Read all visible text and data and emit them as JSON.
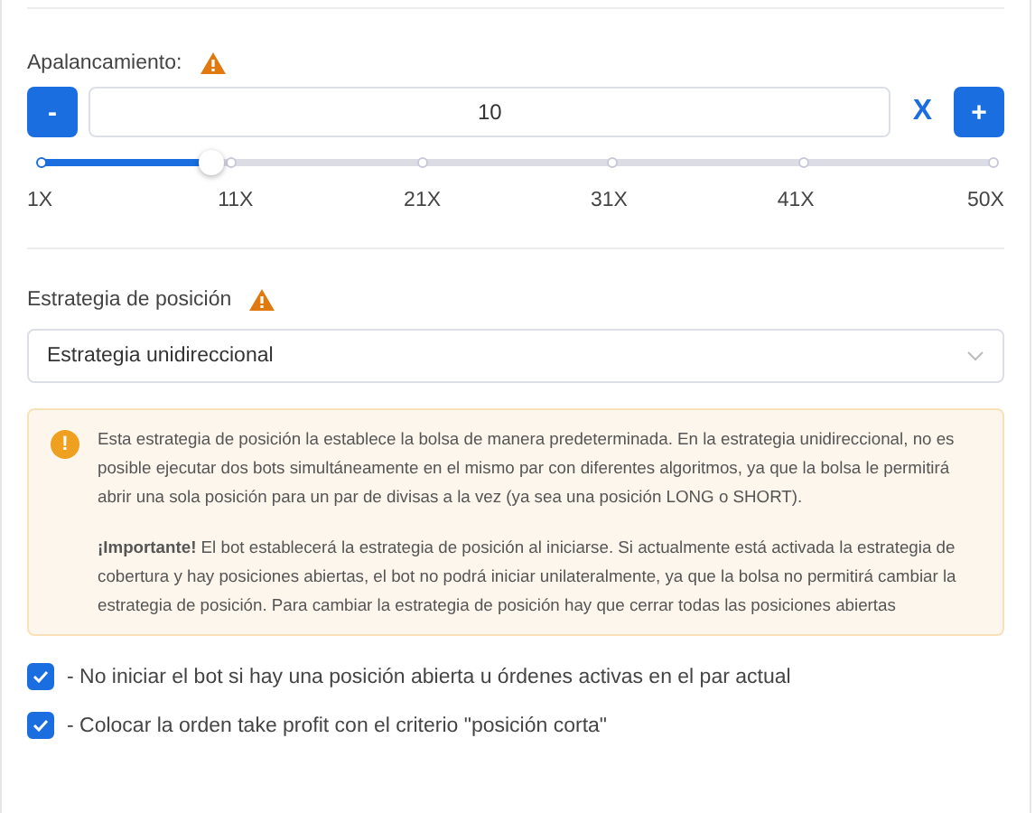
{
  "leverage": {
    "label": "Apalancamiento:",
    "minus": "-",
    "value": "10",
    "unit": "X",
    "plus": "+",
    "level": 0.184,
    "ticks": [
      "1X",
      "11X",
      "21X",
      "31X",
      "41X",
      "50X"
    ]
  },
  "strategy": {
    "label": "Estrategia de posición",
    "value": "Estrategia unidireccional"
  },
  "alert": {
    "icon": "!",
    "paragraphs": [
      "Esta estrategia de posición la establece la bolsa de manera predeterminada. En la estrategia unidireccional, no es posible ejecutar dos bots simultáneamente en el mismo par con diferentes algoritmos, ya que la bolsa le permitirá abrir una sola posición para un par de divisas a la vez (ya sea una posición LONG o SHORT).",
      "**¡Importante!** El bot establecerá la estrategia de posición al iniciarse. Si actualmente está activada la estrategia de cobertura y hay posiciones abiertas, el bot no podrá iniciar unilateralmente, ya que la bolsa no permitirá cambiar la estrategia de posición. Para cambiar la estrategia de posición hay que cerrar todas las posiciones abiertas"
    ]
  },
  "options": [
    {
      "label": "- No iniciar el bot si hay una posición abierta u órdenes activas en el par actual",
      "checked": true
    },
    {
      "label": "- Colocar la orden take profit con el criterio \"posición corta\"",
      "checked": true
    }
  ]
}
